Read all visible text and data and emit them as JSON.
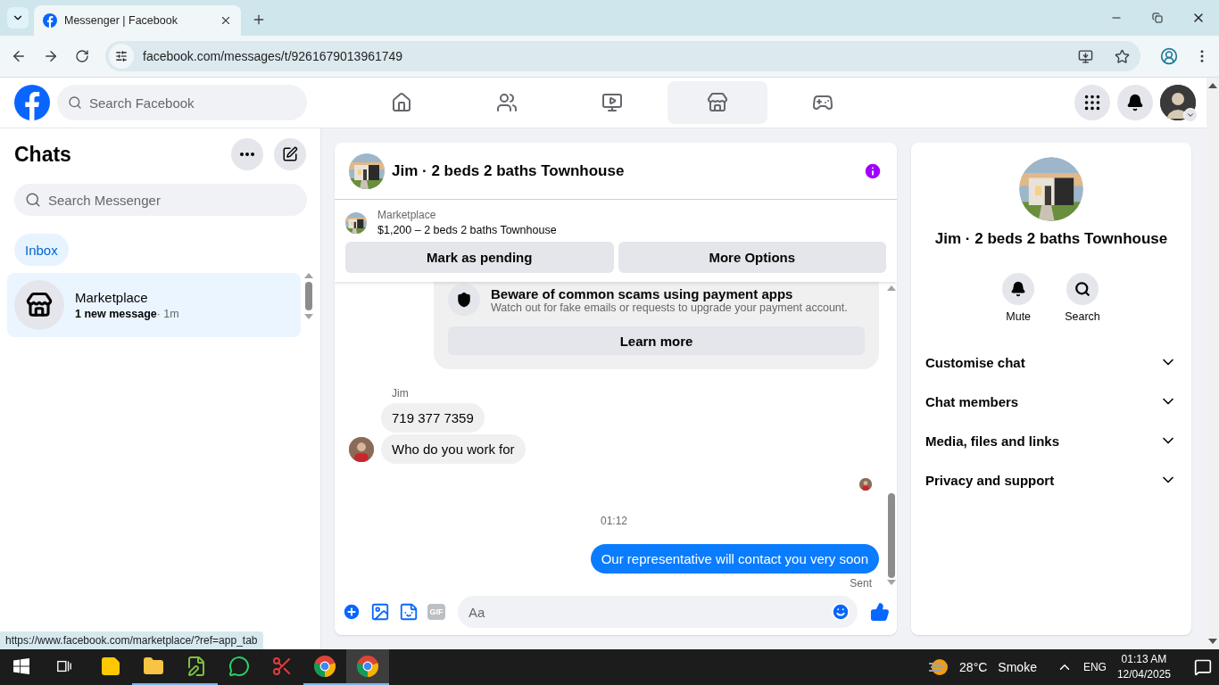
{
  "browser": {
    "tabs": [
      {
        "title": "Messenger | Facebook",
        "selected": true
      }
    ],
    "url": "facebook.com/messages/t/9261679013961749"
  },
  "header": {
    "search_placeholder": "Search Facebook",
    "nav": [
      {
        "kind": "home",
        "selected": false
      },
      {
        "kind": "friends",
        "selected": false
      },
      {
        "kind": "video",
        "selected": false
      },
      {
        "kind": "marketplace",
        "selected": true
      },
      {
        "kind": "gaming",
        "selected": false
      }
    ]
  },
  "chats": {
    "title": "Chats",
    "search_placeholder": "Search Messenger",
    "filters": [
      {
        "label": "Inbox",
        "selected": true
      }
    ],
    "conversations": [
      {
        "name": "Marketplace",
        "preview": "1 new message",
        "time": "· 1m",
        "selected": true
      }
    ]
  },
  "conversation": {
    "title": "Jim · 2 beds 2 baths Townhouse",
    "listing": {
      "source": "Marketplace",
      "title": "$1,200 – 2 beds 2 baths Townhouse"
    },
    "actions": [
      "Mark as pending",
      "More Options"
    ],
    "notice": {
      "title": "Beware of common scams using payment apps",
      "body": "Watch out for fake emails or requests to upgrade your payment account.",
      "button": "Learn more"
    },
    "messages": [
      {
        "kind": "sender_name",
        "text": "Jim"
      },
      {
        "kind": "incoming",
        "text": "719 377 7359",
        "avatar": false
      },
      {
        "kind": "incoming",
        "text": "Who do you work for",
        "avatar": true
      },
      {
        "kind": "read_receipt"
      },
      {
        "kind": "timestamp",
        "text": "01:12"
      },
      {
        "kind": "outgoing",
        "text": "Our representative will contact you very soon"
      },
      {
        "kind": "status",
        "text": "Sent"
      }
    ],
    "composer": {
      "gif_label": "GIF",
      "placeholder": "Aa"
    }
  },
  "info": {
    "title": "Jim · 2 beds 2 baths Townhouse",
    "actions": [
      {
        "kind": "mute",
        "label": "Mute"
      },
      {
        "kind": "search",
        "label": "Search"
      }
    ],
    "sections": [
      {
        "label": "Customise chat",
        "expanded": false
      },
      {
        "label": "Chat members",
        "expanded": false
      },
      {
        "label": "Media, files and links",
        "expanded": false
      },
      {
        "label": "Privacy and support",
        "expanded": false
      }
    ]
  },
  "status_url": "https://www.facebook.com/marketplace/?ref=app_tab",
  "taskbar": {
    "apps": [
      {
        "kind": "sticky_notes",
        "open": false,
        "active": false
      },
      {
        "kind": "file_explorer",
        "open": true,
        "active": false
      },
      {
        "kind": "notepad",
        "open": true,
        "active": false
      },
      {
        "kind": "whatsapp",
        "open": false,
        "active": false
      },
      {
        "kind": "snipping",
        "open": false,
        "active": false
      },
      {
        "kind": "chrome",
        "open": true,
        "active": false
      },
      {
        "kind": "chrome",
        "open": true,
        "active": true
      }
    ],
    "temperature": "28°C",
    "weather": "Smoke",
    "language": "ENG",
    "time": "01:13 AM",
    "date": "12/04/2025"
  }
}
